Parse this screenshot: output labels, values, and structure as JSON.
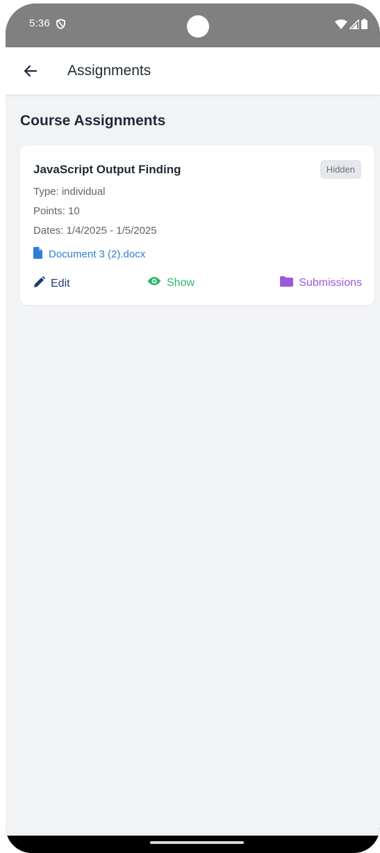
{
  "status_bar": {
    "time": "5:36",
    "icons": [
      "shield-icon",
      "wifi-icon",
      "signal-icon",
      "battery-icon"
    ]
  },
  "app_bar": {
    "title": "Assignments",
    "back_icon": "arrow-left-icon"
  },
  "main": {
    "section_title": "Course Assignments",
    "assignments": [
      {
        "title": "JavaScript Output Finding",
        "badge": "Hidden",
        "type": "Type: individual",
        "points": "Points: 10",
        "dates": "Dates: 1/4/2025 - 1/5/2025",
        "attachment": "Document 3 (2).docx",
        "actions": {
          "edit": "Edit",
          "show": "Show",
          "submissions": "Submissions"
        }
      }
    ]
  },
  "colors": {
    "status_bar": "#808080",
    "background": "#f2f3f5",
    "attachment": "#2f7fd4",
    "edit": "#1e3a6e",
    "show": "#2fb56b",
    "submissions": "#9b59d8",
    "badge_bg": "#e5e7eb"
  }
}
